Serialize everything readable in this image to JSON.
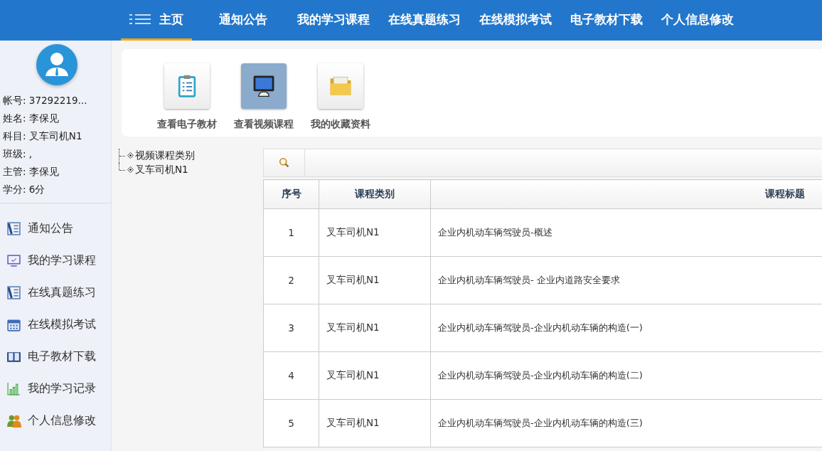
{
  "nav": {
    "items": [
      {
        "label": "主页",
        "selected": true,
        "kind": "home"
      },
      {
        "label": "通知公告",
        "selected": false
      },
      {
        "label": "我的学习课程",
        "selected": false
      },
      {
        "label": "在线真题练习",
        "selected": false
      },
      {
        "label": "在线模拟考试",
        "selected": false
      },
      {
        "label": "电子教材下载",
        "selected": false
      },
      {
        "label": "个人信息修改",
        "selected": false
      }
    ]
  },
  "profile": {
    "fields": [
      {
        "label": "帐号:",
        "value": "37292219..."
      },
      {
        "label": "姓名:",
        "value": "李保见"
      },
      {
        "label": "科目:",
        "value": "叉车司机N1"
      },
      {
        "label": "班级:",
        "value": ","
      },
      {
        "label": "主管:",
        "value": "李保见"
      },
      {
        "label": "学分:",
        "value": "6分"
      }
    ]
  },
  "sidebar": {
    "items": [
      {
        "label": "通知公告",
        "kind": "notice"
      },
      {
        "label": "我的学习课程",
        "kind": "monitor"
      },
      {
        "label": "在线真题练习",
        "kind": "notice"
      },
      {
        "label": "在线模拟考试",
        "kind": "calendar"
      },
      {
        "label": "电子教材下载",
        "kind": "book"
      },
      {
        "label": "我的学习记录",
        "kind": "chart"
      },
      {
        "label": "个人信息修改",
        "kind": "people"
      }
    ]
  },
  "shortcuts": [
    {
      "label": "查看电子教材",
      "kind": "clipboard",
      "selected": false
    },
    {
      "label": "查看视频课程",
      "kind": "monitor",
      "selected": true
    },
    {
      "label": "我的收藏资料",
      "kind": "folder",
      "selected": false
    }
  ],
  "tree": {
    "items": [
      {
        "label": "视频课程类别"
      },
      {
        "label": "叉车司机N1"
      }
    ]
  },
  "table": {
    "columns": [
      "序号",
      "课程类别",
      "课程标题"
    ],
    "rows": [
      [
        "1",
        "叉车司机N1",
        "企业内机动车辆驾驶员-概述"
      ],
      [
        "2",
        "叉车司机N1",
        "企业内机动车辆驾驶员- 企业内道路安全要求"
      ],
      [
        "3",
        "叉车司机N1",
        "企业内机动车辆驾驶员-企业内机动车辆的构造(一)"
      ],
      [
        "4",
        "叉车司机N1",
        "企业内机动车辆驾驶员-企业内机动车辆的构造(二)"
      ],
      [
        "5",
        "叉车司机N1",
        "企业内机动车辆驾驶员-企业内机动车辆的构造(三)"
      ]
    ]
  }
}
